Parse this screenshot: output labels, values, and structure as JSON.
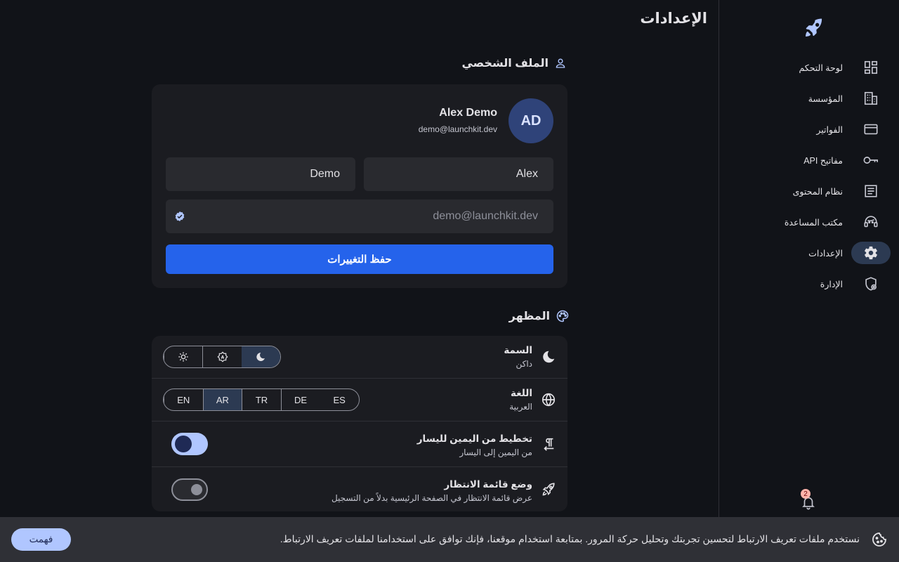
{
  "colors": {
    "accent": "#2563eb",
    "selected": "#2c3a52",
    "primary_light": "#b0c6ff"
  },
  "sidebar": {
    "logo": "rocket-icon",
    "items": [
      {
        "label": "لوحة التحكم",
        "icon": "dashboard-icon"
      },
      {
        "label": "المؤسسة",
        "icon": "organization-icon"
      },
      {
        "label": "الفواتير",
        "icon": "credit-card-icon"
      },
      {
        "label": "مفاتيح API",
        "icon": "key-icon"
      },
      {
        "label": "نظام المحتوى",
        "icon": "article-icon"
      },
      {
        "label": "مكتب المساعدة",
        "icon": "support-agent-icon"
      },
      {
        "label": "الإعدادات",
        "icon": "gear-icon",
        "active": true
      },
      {
        "label": "الإدارة",
        "icon": "admin-shield-icon"
      }
    ],
    "notifications": {
      "count": "2"
    }
  },
  "page": {
    "title": "الإعدادات"
  },
  "profile": {
    "heading": "الملف الشخصي",
    "initials": "AD",
    "name": "Alex Demo",
    "email": "demo@launchkit.dev",
    "first_name": "Alex",
    "last_name": "Demo",
    "email_field": "demo@launchkit.dev",
    "save_label": "حفظ التغييرات"
  },
  "appearance": {
    "heading": "المظهر",
    "theme": {
      "title": "السمة",
      "value": "داكن",
      "options": [
        "light",
        "auto",
        "dark"
      ],
      "selected": "dark"
    },
    "language": {
      "title": "اللغة",
      "value": "العربية",
      "options": [
        "EN",
        "AR",
        "TR",
        "DE",
        "ES"
      ],
      "selected": "AR"
    },
    "rtl": {
      "title": "تخطيط من اليمين لليسار",
      "sub": "من اليمين إلى اليسار",
      "on": true
    },
    "waitlist": {
      "title": "وضع قائمة الانتظار",
      "sub": "عرض قائمة الانتظار في الصفحة الرئيسية بدلاً من التسجيل",
      "on": false
    }
  },
  "cookie": {
    "text": "نستخدم ملفات تعريف الارتباط لتحسين تجربتك وتحليل حركة المرور. بمتابعة استخدام موقعنا، فإنك توافق على استخدامنا لملفات تعريف الارتباط.",
    "button": "فهمت"
  }
}
